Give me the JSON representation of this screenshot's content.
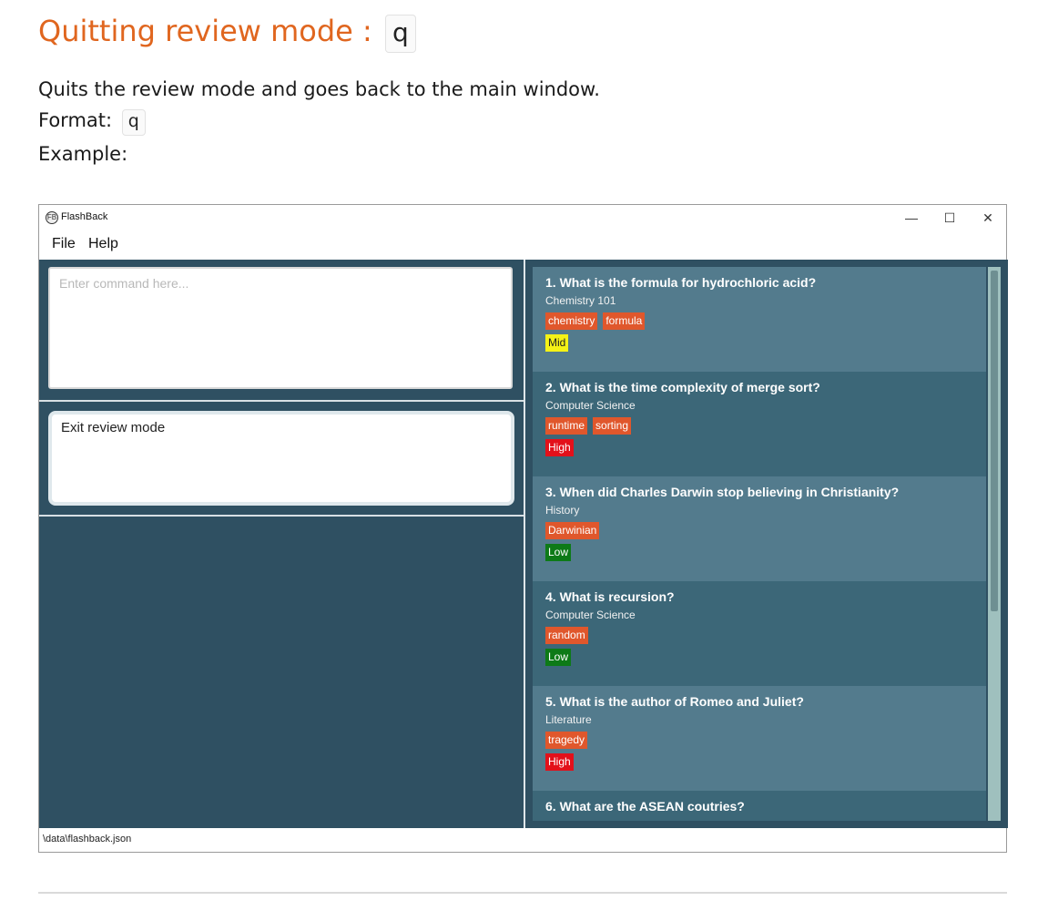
{
  "doc": {
    "heading": "Quitting review mode :",
    "heading_code": "q",
    "description": "Quits the review mode and goes back to the main window.",
    "format_label": "Format:",
    "format_code": "q",
    "example_label": "Example:"
  },
  "app": {
    "title": "FlashBack",
    "logo_glyph": "FB",
    "controls": {
      "minimize": "—",
      "maximize": "☐",
      "close": "✕"
    },
    "menu": [
      "File",
      "Help"
    ],
    "command_placeholder": "Enter command here...",
    "result_text": "Exit review mode",
    "status_path": "\\data\\flashback.json",
    "cards": [
      {
        "question": "1.  What is the formula for hydrochloric acid?",
        "category": "Chemistry 101",
        "tags": [
          "chemistry",
          "formula"
        ],
        "difficulty": "Mid"
      },
      {
        "question": "2.  What is the time complexity of merge sort?",
        "category": "Computer Science",
        "tags": [
          "runtime",
          "sorting"
        ],
        "difficulty": "High"
      },
      {
        "question": "3.  When did Charles Darwin stop believing in Christianity?",
        "category": "History",
        "tags": [
          "Darwinian"
        ],
        "difficulty": "Low"
      },
      {
        "question": "4.  What is recursion?",
        "category": "Computer Science",
        "tags": [
          "random"
        ],
        "difficulty": "Low"
      },
      {
        "question": "5.  What is the author of Romeo and Juliet?",
        "category": "Literature",
        "tags": [
          "tragedy"
        ],
        "difficulty": "High"
      },
      {
        "question": "6.  What are the ASEAN coutries?",
        "category": "",
        "tags": [],
        "difficulty": ""
      }
    ]
  },
  "colors": {
    "heading_accent": "#e0661f",
    "pane_background": "#2f5062",
    "card_light": "#537b8d",
    "card_dark": "#3c6778",
    "tag": "#e0572c",
    "difficulty_mid": "#f5f216",
    "difficulty_high": "#e3101a",
    "difficulty_low": "#0d7a17"
  }
}
